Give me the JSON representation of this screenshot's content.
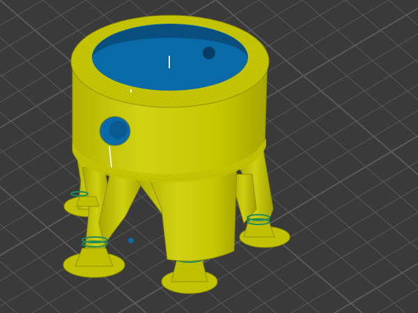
{
  "viewport": {
    "kind": "slicer-3d-preview",
    "colors": {
      "background": "#3a3a3a",
      "grid": "#5a5a5a",
      "model": "#c8c800",
      "model_shadow": "#8f8f00",
      "model_highlight": "#e2e22a",
      "interior": "#0a6aa8",
      "interior_dark": "#084f80",
      "bands": "#1f8a5a"
    }
  },
  "model": {
    "parts": [
      "cylinder-body",
      "tree-supports",
      "support-feet",
      "port-holes"
    ]
  }
}
